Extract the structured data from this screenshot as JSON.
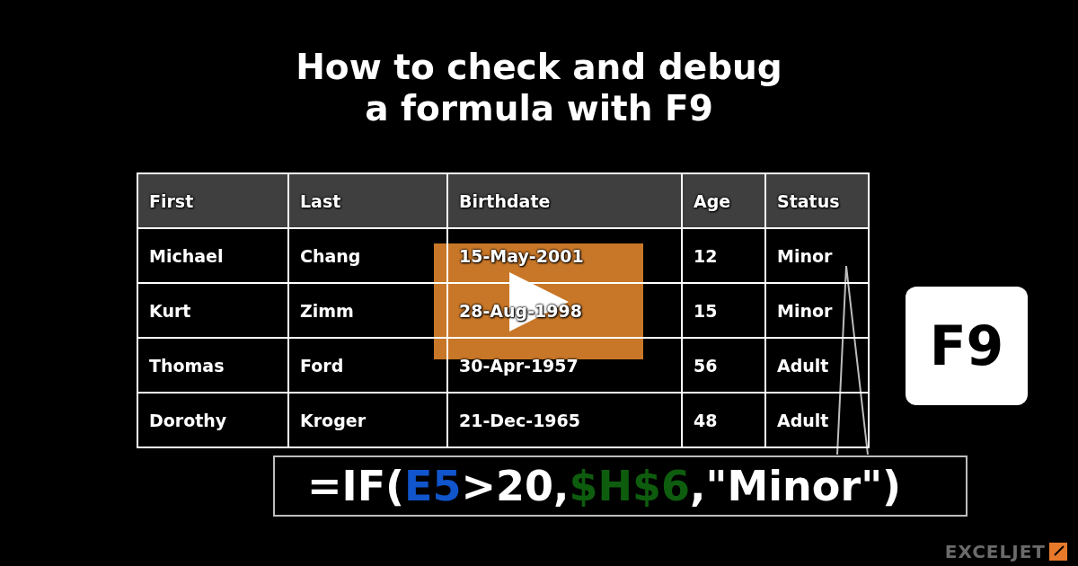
{
  "title": "How to check and debug a formula with F9",
  "table": {
    "columns": [
      "First",
      "Last",
      "Birthdate",
      "Age",
      "Status"
    ],
    "rows": [
      [
        "Michael",
        "Chang",
        "15-May-2001",
        "12",
        "Minor"
      ],
      [
        "Kurt",
        "Zimm",
        "28-Aug-1998",
        "15",
        "Minor"
      ],
      [
        "Thomas",
        "Ford",
        "30-Apr-1957",
        "56",
        "Adult"
      ],
      [
        "Dorothy",
        "Kroger",
        "21-Dec-1965",
        "48",
        "Adult"
      ]
    ]
  },
  "formula": {
    "segments": [
      {
        "text": "=IF(",
        "color": "#ffffff"
      },
      {
        "text": "E5",
        "color": "#1155cc"
      },
      {
        "text": ">20,",
        "color": "#ffffff"
      },
      {
        "text": "$H$6",
        "color": "#0e5c0e"
      },
      {
        "text": ",\"Minor\")",
        "color": "#ffffff"
      }
    ]
  },
  "key": {
    "label": "F9"
  },
  "logo": {
    "text": "EXCELJET"
  }
}
